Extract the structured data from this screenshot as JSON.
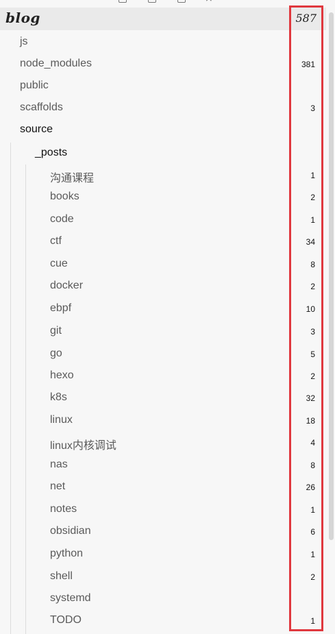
{
  "tree": {
    "root": {
      "name": "blog",
      "count": "587"
    },
    "items": [
      {
        "label": "js",
        "count": ""
      },
      {
        "label": "node_modules",
        "count": "381"
      },
      {
        "label": "public",
        "count": ""
      },
      {
        "label": "scaffolds",
        "count": "3"
      },
      {
        "label": "source",
        "count": ""
      },
      {
        "label": "_posts",
        "count": ""
      },
      {
        "label": "沟通课程",
        "count": "1"
      },
      {
        "label": "books",
        "count": "2"
      },
      {
        "label": "code",
        "count": "1"
      },
      {
        "label": "ctf",
        "count": "34"
      },
      {
        "label": "cue",
        "count": "8"
      },
      {
        "label": "docker",
        "count": "2"
      },
      {
        "label": "ebpf",
        "count": "10"
      },
      {
        "label": "git",
        "count": "3"
      },
      {
        "label": "go",
        "count": "5"
      },
      {
        "label": "hexo",
        "count": "2"
      },
      {
        "label": "k8s",
        "count": "32"
      },
      {
        "label": "linux",
        "count": "18"
      },
      {
        "label": "linux内核调试",
        "count": "4"
      },
      {
        "label": "nas",
        "count": "8"
      },
      {
        "label": "net",
        "count": "26"
      },
      {
        "label": "notes",
        "count": "1"
      },
      {
        "label": "obsidian",
        "count": "6"
      },
      {
        "label": "python",
        "count": "1"
      },
      {
        "label": "shell",
        "count": "2"
      },
      {
        "label": "systemd",
        "count": ""
      },
      {
        "label": "TODO",
        "count": "1"
      }
    ]
  },
  "highlight_color": "#e0383e"
}
